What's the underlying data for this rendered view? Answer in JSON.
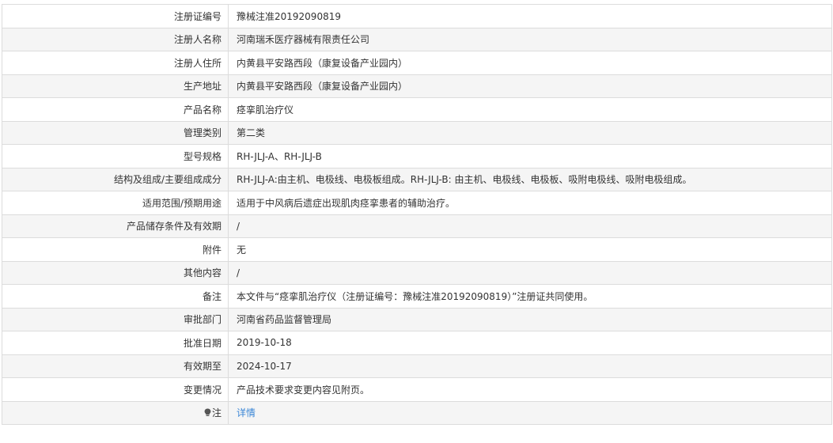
{
  "rows": [
    {
      "label": "注册证编号",
      "value": "豫械注准20192090819"
    },
    {
      "label": "注册人名称",
      "value": "河南瑞禾医疗器械有限责任公司"
    },
    {
      "label": "注册人住所",
      "value": "内黄县平安路西段（康复设备产业园内）"
    },
    {
      "label": "生产地址",
      "value": "内黄县平安路西段（康复设备产业园内）"
    },
    {
      "label": "产品名称",
      "value": "痉挛肌治疗仪"
    },
    {
      "label": "管理类别",
      "value": "第二类"
    },
    {
      "label": "型号规格",
      "value": "RH-JLJ-A、RH-JLJ-B"
    },
    {
      "label": "结构及组成/主要组成成分",
      "value": "RH-JLJ-A:由主机、电极线、电极板组成。RH-JLJ-B: 由主机、电极线、电极板、吸附电极线、吸附电极组成。"
    },
    {
      "label": "适用范围/预期用途",
      "value": "适用于中风病后遗症出现肌肉痉挛患者的辅助治疗。"
    },
    {
      "label": "产品储存条件及有效期",
      "value": "/"
    },
    {
      "label": "附件",
      "value": "无"
    },
    {
      "label": "其他内容",
      "value": "/"
    },
    {
      "label": "备注",
      "value": "本文件与“痉挛肌治疗仪（注册证编号：豫械注准20192090819）”注册证共同使用。"
    },
    {
      "label": "审批部门",
      "value": "河南省药品监督管理局"
    },
    {
      "label": "批准日期",
      "value": "2019-10-18"
    },
    {
      "label": "有效期至",
      "value": "2024-10-17"
    },
    {
      "label": "变更情况",
      "value": "产品技术要求变更内容见附页。"
    }
  ],
  "note": {
    "icon": "lightbulb-icon",
    "label": "注",
    "link_text": "详情",
    "link_color": "#3a86d6"
  }
}
